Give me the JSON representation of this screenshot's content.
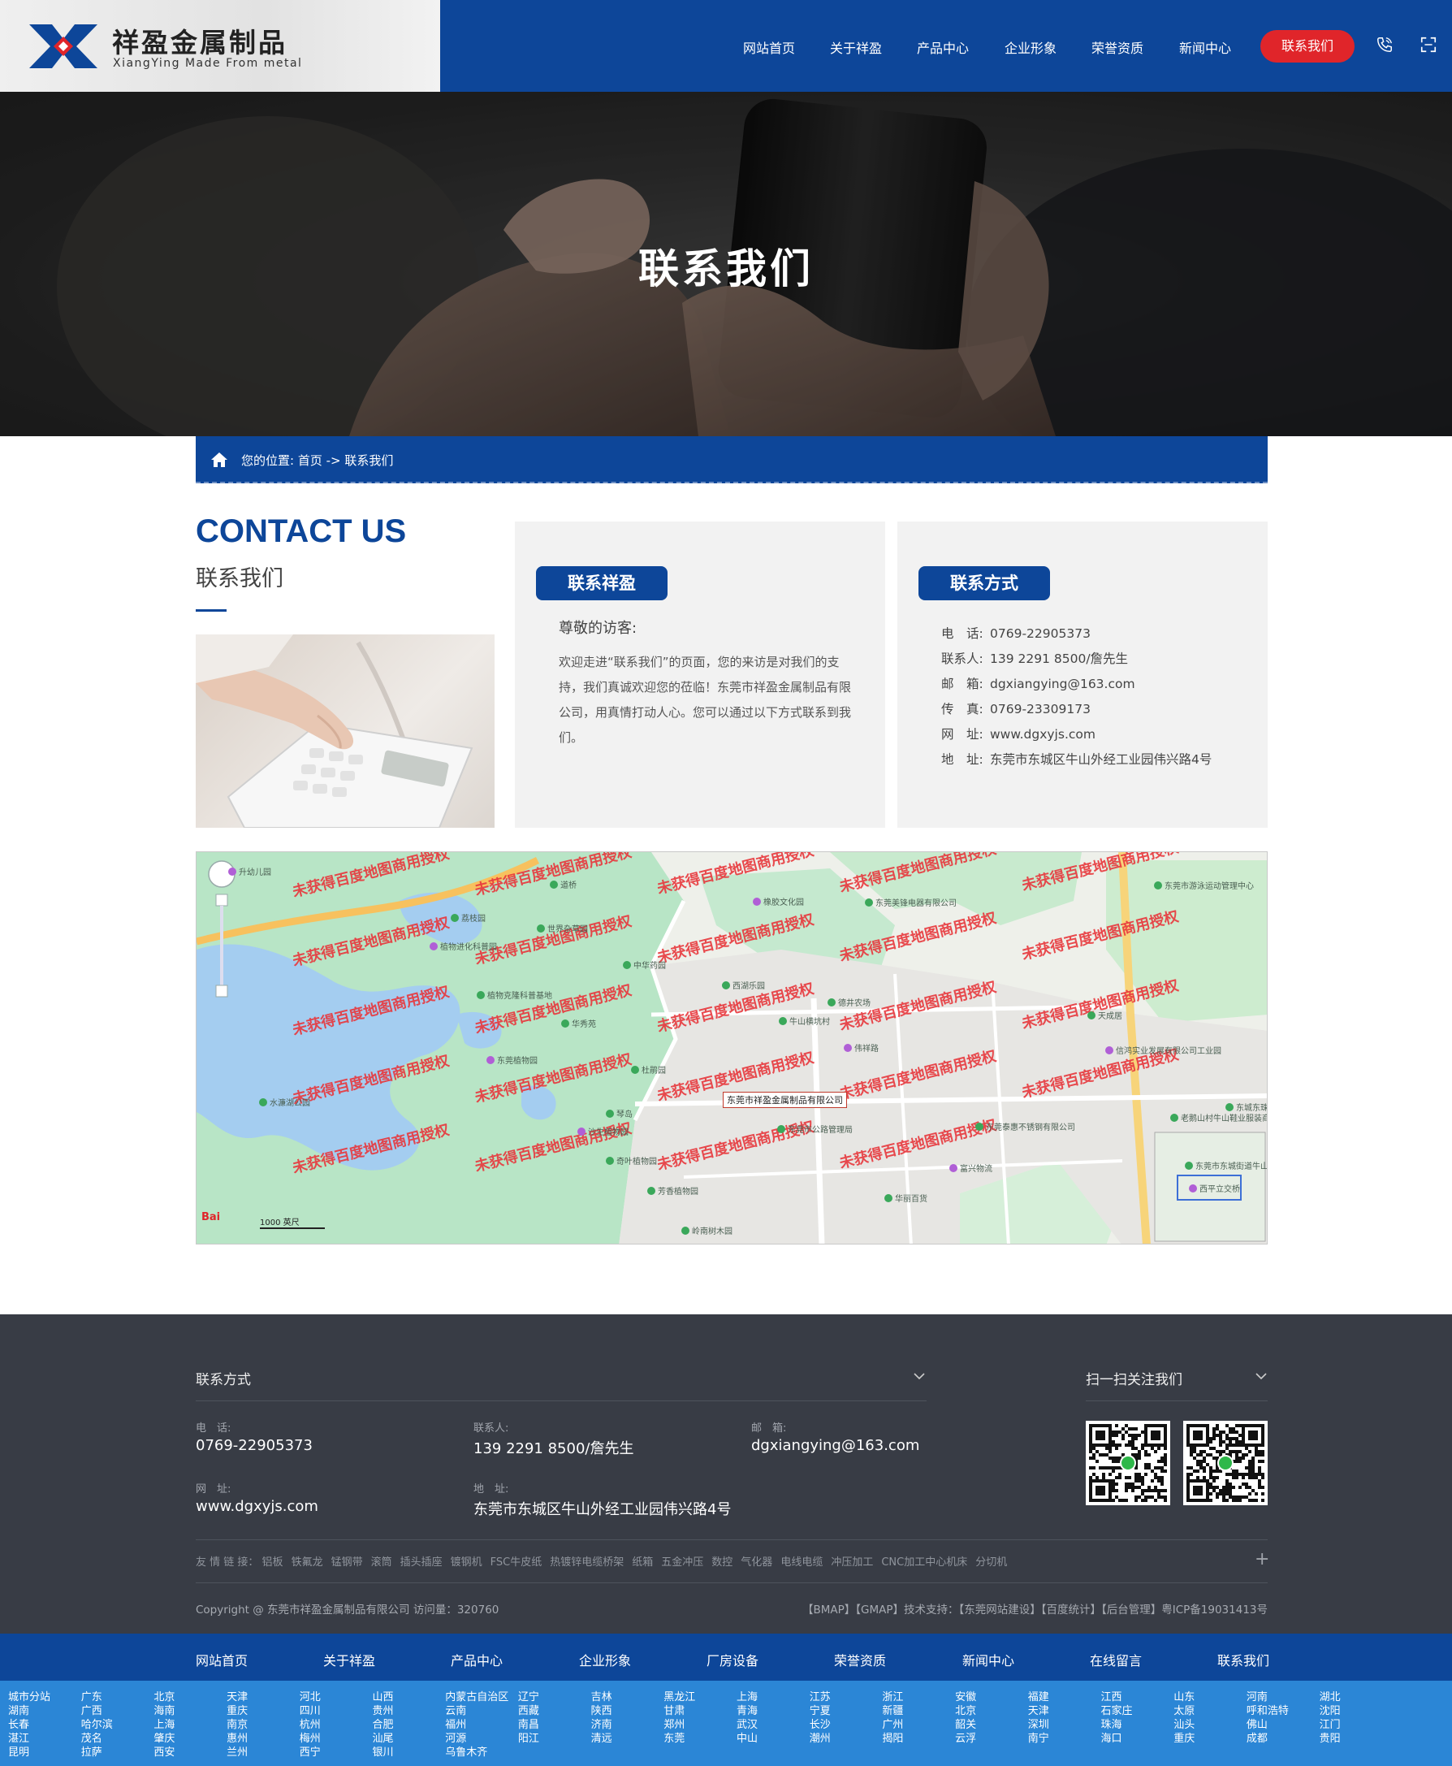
{
  "header": {
    "logo_cn": "祥盈金属制品",
    "logo_en": "XiangYing Made From metal",
    "nav": [
      "网站首页",
      "关于祥盈",
      "产品中心",
      "企业形象",
      "荣誉资质",
      "新闻中心"
    ],
    "cta": "联系我们",
    "colors": {
      "primary": "#0d4699",
      "cta": "#e0252a"
    }
  },
  "banner": {
    "title": "联系我们"
  },
  "breadcrumb": {
    "text": "您的位置: 首页 -> 联系我们"
  },
  "contact": {
    "heading_en": "CONTACT US",
    "heading_cn": "联系我们",
    "welcome": {
      "badge": "联系祥盈",
      "greeting": "尊敬的访客:",
      "paragraph": "欢迎走进“联系我们”的页面，您的来访是对我们的支持，我们真诚欢迎您的莅临！东莞市祥盈金属制品有限公司，用真情打动人心。您可以通过以下方式联系到我们。"
    },
    "methods": {
      "badge": "联系方式",
      "rows": [
        {
          "label": "电　话:",
          "value": "0769-22905373"
        },
        {
          "label": "联系人:",
          "value": "139 2291 8500/詹先生"
        },
        {
          "label": "邮　箱:",
          "value": "dgxiangying@163.com"
        },
        {
          "label": "传　真:",
          "value": "0769-23309173"
        },
        {
          "label": "网　址:",
          "value": "www.dgxyjs.com"
        },
        {
          "label": "地　址:",
          "value": "东莞市东城区牛山外经工业园伟兴路4号"
        }
      ]
    }
  },
  "map": {
    "watermark": "未获得百度地图商用授权",
    "company_label": "东莞市祥盈金属制品有限公司",
    "scale": "1000 英尺",
    "baidu": "Bai",
    "places": [
      "升幼儿园",
      "荔枝园",
      "道桥",
      "世界杂草园",
      "植物进化科普园",
      "中华药园",
      "植物克隆科普基地",
      "华秀苑",
      "东莞植物园",
      "水濂湖公园",
      "杜鹃园",
      "琴岛",
      "沙生植物园",
      "奇叶植物园",
      "芳香植物园",
      "岭南树木园",
      "橡胶文化园",
      "西湖乐园",
      "德井农场",
      "牛山横坑村",
      "伟祥路",
      "东莞美锋电器有限公司",
      "东莞市游泳运动管理中心",
      "天成居",
      "信鸿实业发展有限公司工业园",
      "老鹅山村牛山鞋业服装商业街",
      "东城东珠学校",
      "东莞市公路管理局",
      "富兴物流",
      "华丽百货",
      "东莞泰惠不锈钢有限公司",
      "东莞市东城街道牛山社区卫生服务站",
      "西平立交桥",
      "东莞植物园"
    ]
  },
  "footer": {
    "contact_title": "联系方式",
    "follow_title": "扫一扫关注我们",
    "fields": [
      {
        "label": "电　话:",
        "value": "0769-22905373"
      },
      {
        "label": "联系人:",
        "value": "139 2291 8500/詹先生"
      },
      {
        "label": "邮　箱:",
        "value": "dgxiangying@163.com"
      },
      {
        "label": "网　址:",
        "value": "www.dgxyjs.com"
      },
      {
        "label": "地　址:",
        "value": "东莞市东城区牛山外经工业园伟兴路4号"
      }
    ],
    "links_label": "友 情 链 接：",
    "links": [
      "铝板",
      "铁氟龙",
      "锰钢带",
      "滚筒",
      "插头插座",
      "镀钢机",
      "FSC牛皮纸",
      "热镀锌电缆桥架",
      "纸箱",
      "五金冲压",
      "数控",
      "气化器",
      "电线电缆",
      "冲压加工",
      "CNC加工中心机床",
      "分切机"
    ],
    "copyright": "Copyright @ 东莞市祥盈金属制品有限公司 访问量：320760",
    "right_links": "【BMAP】【GMAP】技术支持：【东莞网站建设】【百度统计】【后台管理】粤ICP备19031413号"
  },
  "bottom_nav": [
    "网站首页",
    "关于祥盈",
    "产品中心",
    "企业形象",
    "厂房设备",
    "荣誉资质",
    "新闻中心",
    "在线留言",
    "联系我们"
  ],
  "cities": [
    [
      "城市分站",
      "湖南",
      "长春",
      "湛江",
      "昆明"
    ],
    [
      "广东",
      "广西",
      "哈尔滨",
      "茂名",
      "拉萨"
    ],
    [
      "北京",
      "海南",
      "上海",
      "肇庆",
      "西安"
    ],
    [
      "天津",
      "重庆",
      "南京",
      "惠州",
      "兰州"
    ],
    [
      "河北",
      "四川",
      "杭州",
      "梅州",
      "西宁"
    ],
    [
      "山西",
      "贵州",
      "合肥",
      "汕尾",
      "银川"
    ],
    [
      "内蒙古自治区",
      "云南",
      "福州",
      "河源",
      "乌鲁木齐"
    ],
    [
      "辽宁",
      "西藏",
      "南昌",
      "阳江"
    ],
    [
      "吉林",
      "陕西",
      "济南",
      "清远"
    ],
    [
      "黑龙江",
      "甘肃",
      "郑州",
      "东莞"
    ],
    [
      "上海",
      "青海",
      "武汉",
      "中山"
    ],
    [
      "江苏",
      "宁夏",
      "长沙",
      "潮州"
    ],
    [
      "浙江",
      "新疆",
      "广州",
      "揭阳"
    ],
    [
      "安徽",
      "北京",
      "韶关",
      "云浮"
    ],
    [
      "福建",
      "天津",
      "深圳",
      "南宁"
    ],
    [
      "江西",
      "石家庄",
      "珠海",
      "海口"
    ],
    [
      "山东",
      "太原",
      "汕头",
      "重庆"
    ],
    [
      "河南",
      "呼和浩特",
      "佛山",
      "成都"
    ],
    [
      "湖北",
      "沈阳",
      "江门",
      "贵阳"
    ]
  ]
}
